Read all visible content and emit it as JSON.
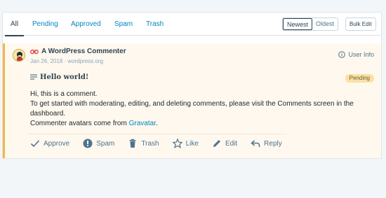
{
  "tabs": [
    {
      "label": "All"
    },
    {
      "label": "Pending"
    },
    {
      "label": "Approved"
    },
    {
      "label": "Spam"
    },
    {
      "label": "Trash"
    }
  ],
  "sort": {
    "newest": "Newest",
    "oldest": "Oldest"
  },
  "bulk_edit": "Bulk Edit",
  "comment": {
    "author": "A WordPress Commenter",
    "date": "Jan 26, 2018",
    "site": "wordpress.org",
    "user_info": "User Info",
    "post_title": "Hello world!",
    "status": "Pending",
    "line1": "Hi, this is a comment.",
    "line2": "To get started with moderating, editing, and deleting comments, please visit the Comments screen in the dashboard.",
    "line3_prefix": "Commenter avatars come from ",
    "line3_link": "Gravatar",
    "line3_suffix": "."
  },
  "actions": {
    "approve": "Approve",
    "spam": "Spam",
    "trash": "Trash",
    "like": "Like",
    "edit": "Edit",
    "reply": "Reply"
  },
  "colors": {
    "accent": "#0087be",
    "pending_bar": "#f0b849",
    "pending_bg": "#fef8ee"
  }
}
